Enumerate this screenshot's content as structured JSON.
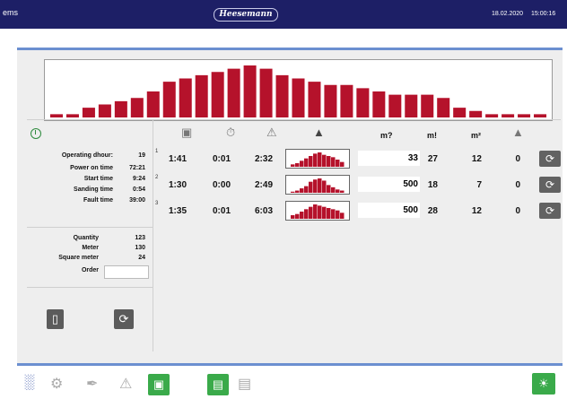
{
  "header": {
    "app_name": "ems",
    "brand": "Heesemann",
    "date": "18.02.2020",
    "time": "15:00:16"
  },
  "colors": {
    "header_bg": "#1d1f66",
    "bar_red": "#b5122b",
    "accent_blue": "#6b8fd0",
    "nav_blue": "#1a3a9a",
    "green": "#3aaa4a"
  },
  "chart_data": {
    "type": "bar",
    "values": [
      1,
      1,
      3,
      4,
      5,
      6,
      8,
      11,
      12,
      13,
      14,
      15,
      16,
      15,
      13,
      12,
      11,
      10,
      10,
      9,
      8,
      7,
      7,
      7,
      6,
      3,
      2,
      1,
      1,
      1,
      1
    ],
    "title": "",
    "xlabel": "",
    "ylabel": ""
  },
  "stats": {
    "operating_label": "Operating dhour:",
    "operating_value": "19",
    "power_on_label": "Power on time",
    "power_on_value": "72:21",
    "start_label": "Start time",
    "start_value": "9:24",
    "sanding_label": "Sanding time",
    "sanding_value": "0:54",
    "fault_label": "Fault time",
    "fault_value": "39:00"
  },
  "counts": {
    "quantity_label": "Quantity",
    "quantity_value": "123",
    "meter_label": "Meter",
    "meter_value": "130",
    "sqm_label": "Square meter",
    "sqm_value": "24",
    "order_label": "Order",
    "order_value": ""
  },
  "table": {
    "headers": [
      "m?",
      "m!",
      "m²"
    ],
    "rows": [
      {
        "num": "1",
        "c1": "1:41",
        "c2": "0:01",
        "c3": "2:32",
        "box": "33",
        "c5": "27",
        "c6": "12",
        "c7": "0",
        "spark": [
          2,
          3,
          5,
          7,
          9,
          11,
          12,
          10,
          9,
          8,
          6,
          4
        ]
      },
      {
        "num": "2",
        "c1": "1:30",
        "c2": "0:00",
        "c3": "2:49",
        "box": "500",
        "c5": "18",
        "c6": "7",
        "c7": "0",
        "spark": [
          1,
          2,
          4,
          6,
          10,
          12,
          13,
          11,
          7,
          5,
          3,
          2
        ]
      },
      {
        "num": "3",
        "c1": "1:35",
        "c2": "0:01",
        "c3": "6:03",
        "box": "500",
        "c5": "28",
        "c6": "12",
        "c7": "0",
        "spark": [
          3,
          4,
          6,
          8,
          10,
          12,
          11,
          10,
          9,
          8,
          7,
          5
        ]
      }
    ]
  },
  "icons": {
    "refresh": "⟳",
    "bars": "📊",
    "gears": "⚙",
    "wrench": "🔧",
    "warning": "⚠",
    "bulb": "💡"
  }
}
